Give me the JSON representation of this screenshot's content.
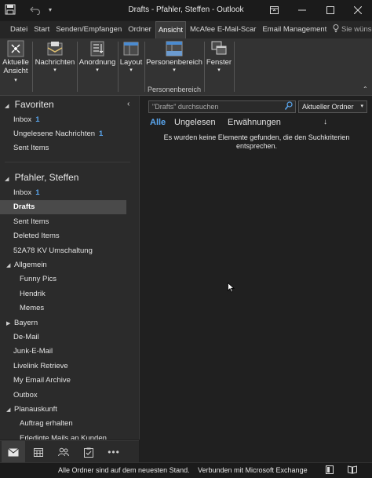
{
  "window": {
    "title": "Drafts - Pfahler, Steffen - Outlook"
  },
  "tabs": [
    {
      "label": "Datei",
      "active": false
    },
    {
      "label": "Start",
      "active": false
    },
    {
      "label": "Senden/Empfangen",
      "active": false
    },
    {
      "label": "Ordner",
      "active": false
    },
    {
      "label": "Ansicht",
      "active": true
    },
    {
      "label": "McAfee E-Mail-Scar",
      "active": false
    },
    {
      "label": "Email Management",
      "active": false
    }
  ],
  "tell_me": "Sie wünsc",
  "ribbon": {
    "aktuelle_ansicht_line1": "Aktuelle",
    "aktuelle_ansicht_line2": "Ansicht",
    "nachrichten": "Nachrichten",
    "anordnung": "Anordnung",
    "layout": "Layout",
    "personenbereich": "Personenbereich",
    "personenbereich_group": "Personenbereich",
    "fenster": "Fenster"
  },
  "nav": {
    "favoriten": "Favoriten",
    "fav_items": [
      {
        "label": "Inbox",
        "count": "1"
      },
      {
        "label": "Ungelesene Nachrichten",
        "count": "1"
      },
      {
        "label": "Sent Items",
        "count": ""
      }
    ],
    "account": "Pfahler, Steffen",
    "items": [
      {
        "label": "Inbox",
        "count": "1",
        "indent": 1,
        "arrow": "",
        "selected": false
      },
      {
        "label": "Drafts",
        "count": "",
        "indent": 1,
        "arrow": "",
        "selected": true
      },
      {
        "label": "Sent Items",
        "count": "",
        "indent": 1,
        "arrow": "",
        "selected": false
      },
      {
        "label": "Deleted Items",
        "count": "",
        "indent": 1,
        "arrow": "",
        "selected": false
      },
      {
        "label": "52A78 KV Umschaltung",
        "count": "",
        "indent": 1,
        "arrow": "",
        "selected": false
      },
      {
        "label": "Allgemein",
        "count": "",
        "indent": 1,
        "arrow": "down",
        "selected": false
      },
      {
        "label": "Funny Pics",
        "count": "",
        "indent": 2,
        "arrow": "",
        "selected": false
      },
      {
        "label": "Hendrik",
        "count": "",
        "indent": 2,
        "arrow": "",
        "selected": false
      },
      {
        "label": "Memes",
        "count": "",
        "indent": 2,
        "arrow": "",
        "selected": false
      },
      {
        "label": "Bayern",
        "count": "",
        "indent": 1,
        "arrow": "right",
        "selected": false
      },
      {
        "label": "De-Mail",
        "count": "",
        "indent": 1,
        "arrow": "",
        "selected": false
      },
      {
        "label": "Junk-E-Mail",
        "count": "",
        "indent": 1,
        "arrow": "",
        "selected": false
      },
      {
        "label": "Livelink Retrieve",
        "count": "",
        "indent": 1,
        "arrow": "",
        "selected": false
      },
      {
        "label": "My Email Archive",
        "count": "",
        "indent": 1,
        "arrow": "",
        "selected": false
      },
      {
        "label": "Outbox",
        "count": "",
        "indent": 1,
        "arrow": "",
        "selected": false
      },
      {
        "label": "Planauskunft",
        "count": "",
        "indent": 1,
        "arrow": "down",
        "selected": false
      },
      {
        "label": "Auftrag erhalten",
        "count": "",
        "indent": 2,
        "arrow": "",
        "selected": false
      },
      {
        "label": "Erledigte Mails an Kunden",
        "count": "",
        "indent": 2,
        "arrow": "",
        "selected": false
      }
    ]
  },
  "content": {
    "search_placeholder": "\"Drafts\" durchsuchen",
    "scope": "Aktueller Ordner",
    "filter_all": "Alle",
    "filter_unread": "Ungelesen",
    "filter_mentions": "Erwähnungen",
    "empty_line1": "Es wurden keine Elemente gefunden, die den Suchkriterien",
    "empty_line2": "entsprechen."
  },
  "status": {
    "left": "Alle Ordner sind auf dem neuesten Stand.",
    "right": "Verbunden mit Microsoft Exchange"
  },
  "colors": {
    "accent": "#5aa7f0",
    "background": "#1f1f1f"
  }
}
